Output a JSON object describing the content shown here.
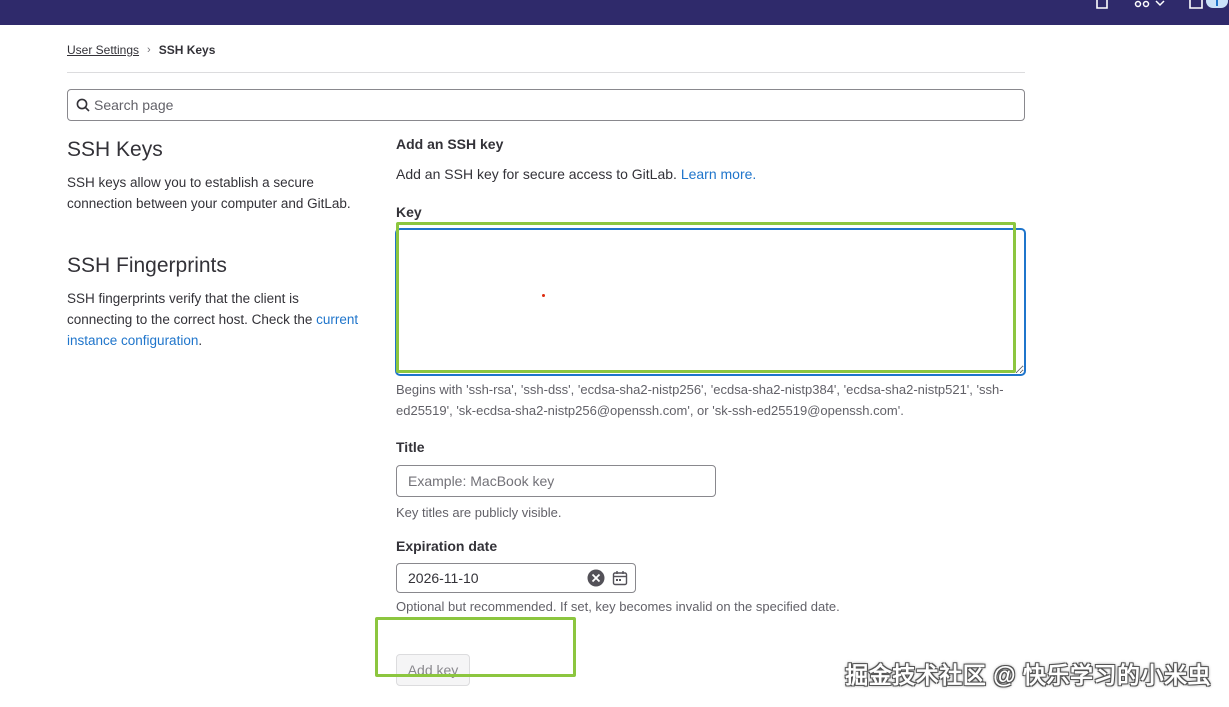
{
  "topbar": {
    "icons": [
      "issues-icon",
      "merge-request-icon",
      "todo-icon"
    ],
    "color": "#2f2a6b"
  },
  "breadcrumb": {
    "parent": "User Settings",
    "current": "SSH Keys"
  },
  "search": {
    "placeholder": "Search page"
  },
  "sidebar": {
    "ssh_keys_title": "SSH Keys",
    "ssh_keys_desc": "SSH keys allow you to establish a secure connection between your computer and GitLab.",
    "fingerprints_title": "SSH Fingerprints",
    "fingerprints_desc": "SSH fingerprints verify that the client is connecting to the correct host. Check the",
    "fingerprints_link": "current instance configuration",
    "fingerprints_suffix": "."
  },
  "form": {
    "heading": "Add an SSH key",
    "intro": "Add an SSH key for secure access to GitLab.",
    "learn_more": "Learn more.",
    "key_label": "Key",
    "key_value": "",
    "key_help": "Begins with 'ssh-rsa', 'ssh-dss', 'ecdsa-sha2-nistp256', 'ecdsa-sha2-nistp384', 'ecdsa-sha2-nistp521', 'ssh-ed25519', 'sk-ecdsa-sha2-nistp256@openssh.com', or 'sk-ssh-ed25519@openssh.com'.",
    "title_label": "Title",
    "title_placeholder": "Example: MacBook key",
    "title_help": "Key titles are publicly visible.",
    "expiration_label": "Expiration date",
    "expiration_value": "2026-11-10",
    "expiration_help": "Optional but recommended. If set, key becomes invalid on the specified date.",
    "submit_label": "Add key"
  },
  "watermark": "掘金技术社区 @ 快乐学习的小米虫",
  "colors": {
    "accent": "#1f75cb",
    "highlight": "#8cc63f"
  }
}
